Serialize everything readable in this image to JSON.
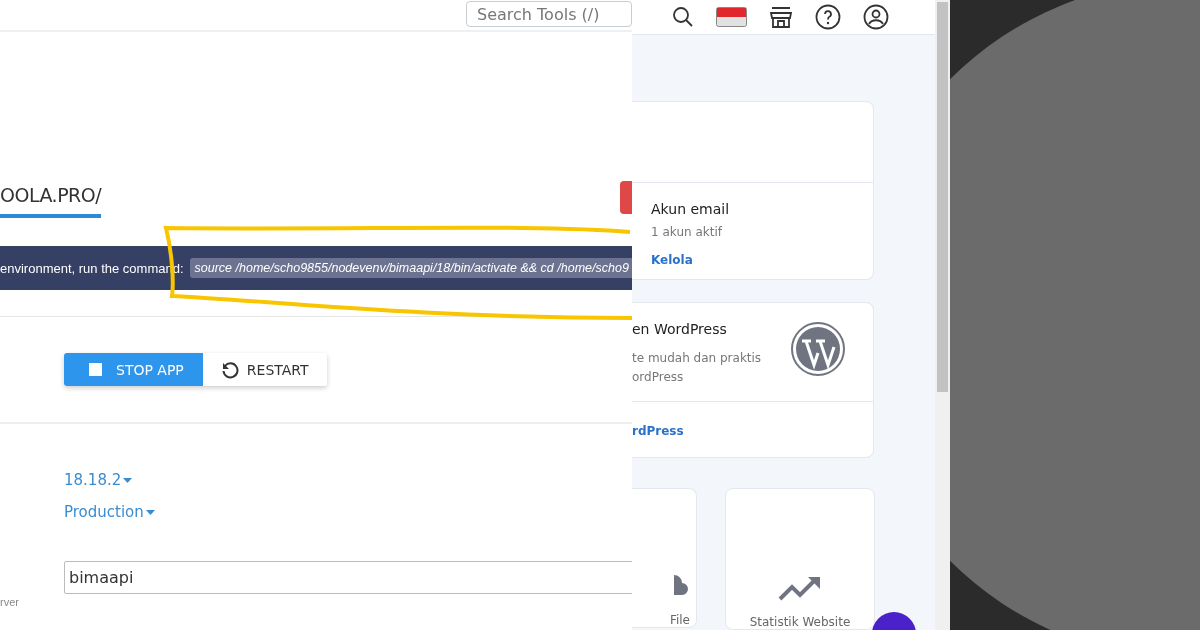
{
  "left_panel": {
    "search": {
      "placeholder": "Search Tools (/)"
    },
    "tab": {
      "label": "OOLA.PRO/",
      "selected": true
    },
    "banner": {
      "text": "environment, run the command:",
      "command": "source /home/scho9855/nodevenv/bimaapi/18/bin/activate && cd /home/scho9"
    },
    "buttons": [
      {
        "label": "STOP APP",
        "kind": "stop"
      },
      {
        "label": "RESTART",
        "kind": "restart"
      }
    ],
    "version_dropdown": "18.18.2",
    "mode_dropdown": "Production",
    "app_name_field": {
      "value": "bimaapi"
    },
    "side_label": "rver"
  },
  "right_panel": {
    "header_icons": [
      {
        "kind": "search"
      },
      {
        "kind": "flag"
      },
      {
        "kind": "store"
      },
      {
        "kind": "help"
      },
      {
        "kind": "user"
      }
    ],
    "email_card": {
      "title": "Akun email",
      "subtitle": "1 akun aktif",
      "link": "Kelola"
    },
    "wordpress_card": {
      "title": "en WordPress",
      "lines": [
        "te mudah dan praktis",
        "ordPress"
      ],
      "link": "rdPress"
    },
    "tiles": [
      {
        "label": "File",
        "kind": "cloud"
      },
      {
        "label": "Statistik Website",
        "kind": "trend"
      }
    ]
  }
}
